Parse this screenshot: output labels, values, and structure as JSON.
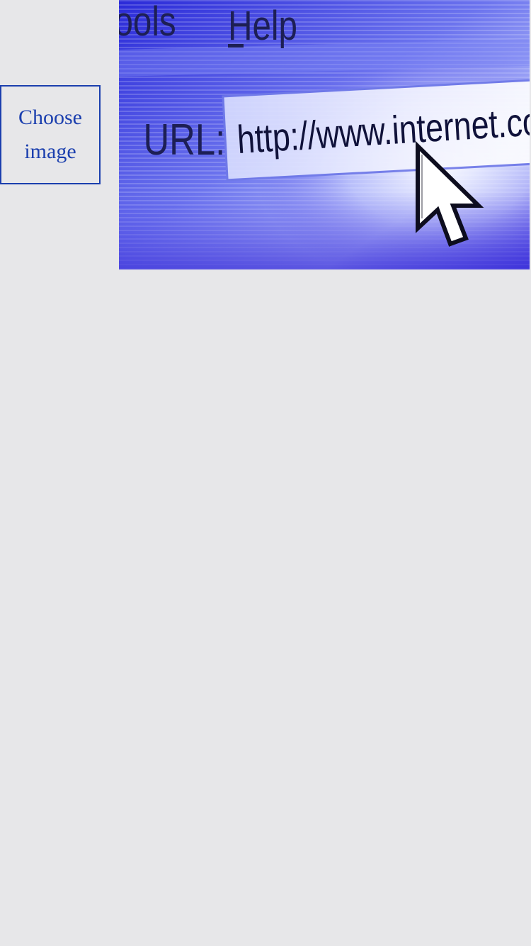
{
  "picker": {
    "button_label": "Choose image"
  },
  "photo": {
    "menu_left": "ools",
    "menu_help": "Help",
    "url_label": "URL:",
    "url_value": "http://www.internet.com",
    "icon": "mouse-pointer-icon",
    "accent_color": "#2b2bd6"
  },
  "colors": {
    "background": "#e7e7e9",
    "button_border": "#1b3fae",
    "button_text": "#1b3fae"
  }
}
